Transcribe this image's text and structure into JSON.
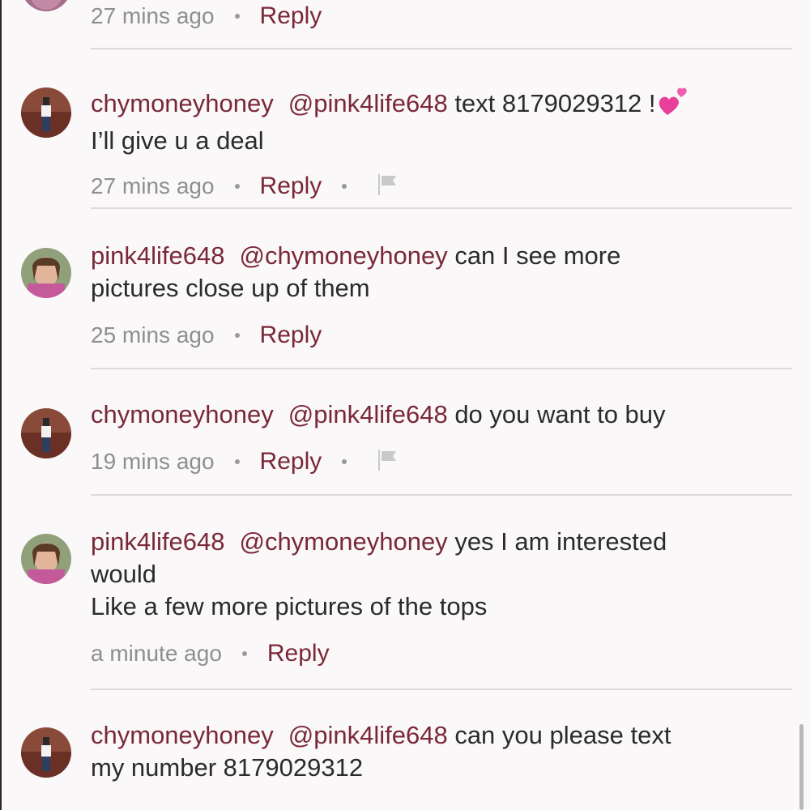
{
  "comments": [
    {
      "id": "c0",
      "time": "27 mins ago",
      "reply_label": "Reply"
    },
    {
      "id": "c1",
      "username": "chymoneyhoney",
      "mention": "@pink4life648",
      "text_line1": "text 8179029312 !",
      "emoji": "two-hearts-icon",
      "text_line2": "I’ll give u a deal",
      "time": "27 mins ago",
      "reply_label": "Reply"
    },
    {
      "id": "c2",
      "username": "pink4life648",
      "mention": "@chymoneyhoney",
      "text_line1": "can I see more",
      "text_line2": "pictures close up of them",
      "time": "25 mins ago",
      "reply_label": "Reply"
    },
    {
      "id": "c3",
      "username": "chymoneyhoney",
      "mention": "@pink4life648",
      "text_line1": "do you want to buy",
      "time": "19 mins ago",
      "reply_label": "Reply"
    },
    {
      "id": "c4",
      "username": "pink4life648",
      "mention": "@chymoneyhoney",
      "text_line1": "yes I am interested",
      "text_line2": "would",
      "text_line3": "Like a few more pictures of the tops",
      "time": "a minute ago",
      "reply_label": "Reply"
    },
    {
      "id": "c5",
      "username": "chymoneyhoney",
      "mention": "@pink4life648",
      "text_line1": "can you please text",
      "text_line2": "my number 8179029312"
    }
  ],
  "colors": {
    "accent": "#7a2838",
    "text": "#2b2b2b",
    "muted": "#8f8f8f",
    "background": "#faf8f9",
    "divider": "#dcdadb"
  },
  "icons": {
    "flag": "flag-icon",
    "heart": "two-hearts-icon"
  }
}
